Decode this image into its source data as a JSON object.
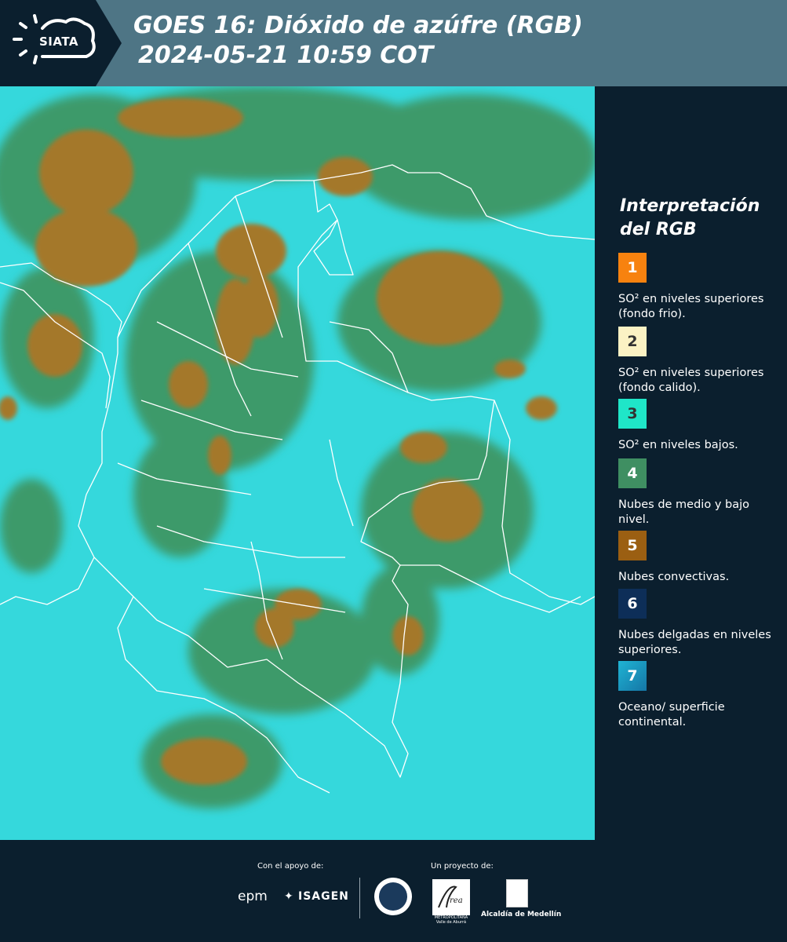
{
  "header": {
    "logo_text": "SIATA",
    "title_line1": "GOES 16: Dióxido de azúfre (RGB)",
    "title_line2": "2024-05-21 10:59 COT"
  },
  "legend": {
    "title_line1": "Interpretación",
    "title_line2": "del RGB",
    "items": [
      {
        "num": "1",
        "color": "#f7820f",
        "text": "SO² en niveles superiores (fondo frio)."
      },
      {
        "num": "2",
        "color": "#fbf2c4",
        "text": "SO² en niveles superiores (fondo calido)."
      },
      {
        "num": "3",
        "color": "#1fe6c8",
        "text": "SO² en niveles bajos."
      },
      {
        "num": "4",
        "color": "#3f8f62",
        "text": "Nubes de medio y bajo nivel."
      },
      {
        "num": "5",
        "color": "#9b5f12",
        "text": "Nubes convectivas."
      },
      {
        "num": "6",
        "color": "#0d2e58",
        "text": "Nubes delgadas en niveles superiores."
      },
      {
        "num": "7",
        "color": "#1990c0",
        "text": "Oceano/ superficie continental."
      }
    ]
  },
  "footer": {
    "support_label": "Con el apoyo de:",
    "project_label": "Un proyecto de:",
    "epm": "epm",
    "isagen": "ISAGEN",
    "area_label": "METROPOLITANA Valle de Aburrá",
    "alcaldia": "Alcaldía de Medellín"
  },
  "colors": {
    "background": "#0b1f2e",
    "header": "#4e7585",
    "cyan": "#35d8dc",
    "green": "#3f9968",
    "brown": "#a77a2a"
  }
}
